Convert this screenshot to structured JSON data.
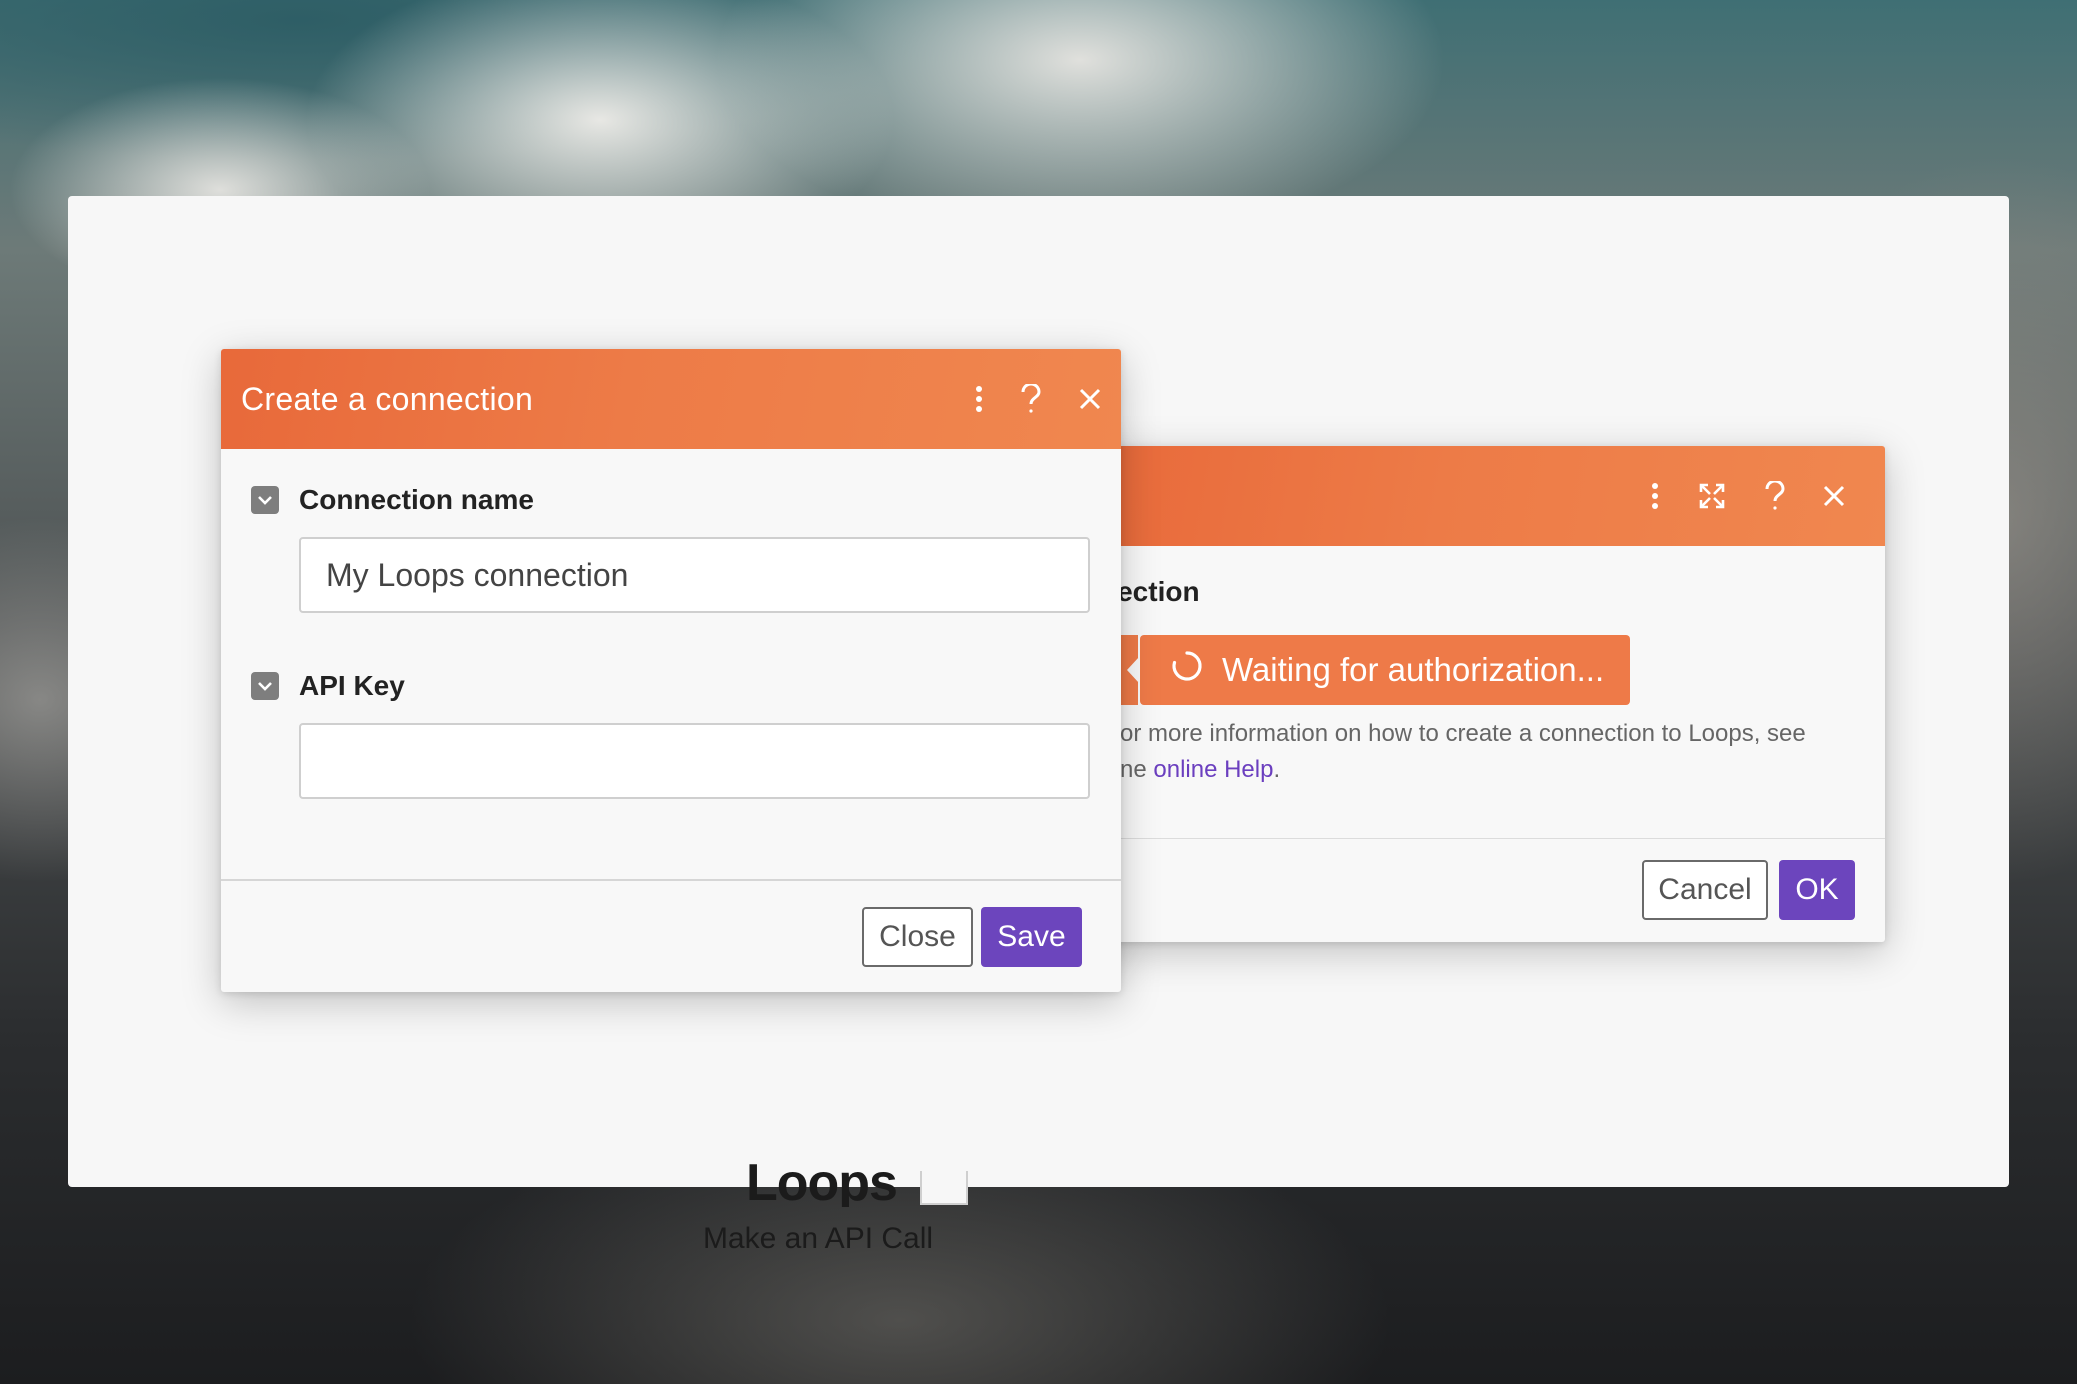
{
  "canvas": {
    "module_title": "Loops",
    "module_subtitle": "Make an API Call"
  },
  "back_dialog": {
    "header_icons": [
      "more-vertical-icon",
      "expand-icon",
      "help-icon",
      "close-icon"
    ],
    "field_label": "nection",
    "auth_button_label": "Waiting for authorization...",
    "help_text_prefix": "or more information on how to create a connection to Loops, see",
    "help_text_line2_prefix": "ne ",
    "help_link": "online Help",
    "help_text_suffix": ".",
    "cancel_label": "Cancel",
    "ok_label": "OK"
  },
  "front_dialog": {
    "title": "Create a connection",
    "header_icons": [
      "more-vertical-icon",
      "help-icon",
      "close-icon"
    ],
    "fields": [
      {
        "label": "Connection name",
        "value": "My Loops connection"
      },
      {
        "label": "API Key",
        "value": ""
      }
    ],
    "close_label": "Close",
    "save_label": "Save"
  },
  "colors": {
    "header_orange": "#ed7b47",
    "primary_purple": "#6c45bd",
    "link_purple": "#6b3fbf"
  }
}
